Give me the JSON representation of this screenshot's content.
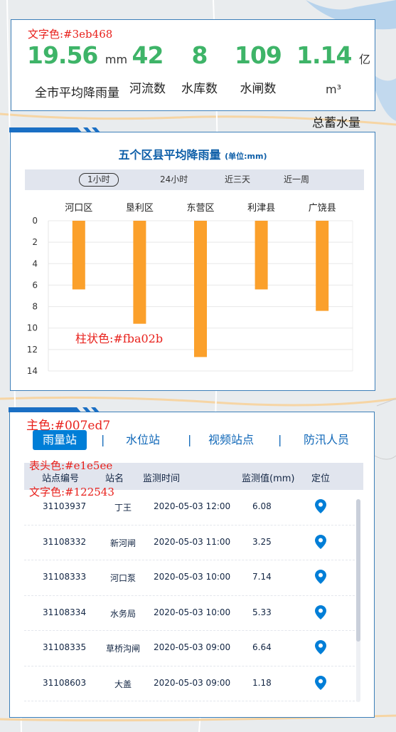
{
  "annotations": {
    "text_color": "文字色:#3eb468",
    "bar_color": "柱状色:#fba02b",
    "main_color": "主色:#007ed7",
    "header_color": "表头色:#e1e5ee",
    "table_text_color": "文字色:#122543"
  },
  "colors": {
    "stat_text": "#3eb468",
    "bar": "#fba02b",
    "primary": "#007ed7",
    "table_header": "#e1e5ee",
    "table_text": "#122543"
  },
  "stats": [
    {
      "value": "19.56",
      "unit": "mm",
      "label": "全市平均降雨量"
    },
    {
      "value": "42",
      "unit": "",
      "label": "河流数"
    },
    {
      "value": "8",
      "unit": "",
      "label": "水库数"
    },
    {
      "value": "109",
      "unit": "",
      "label": "水闸数"
    },
    {
      "value": "1.14",
      "unit": "亿m³",
      "label": "总蓄水量"
    }
  ],
  "chart_panel": {
    "title": "五个区县平均降雨量",
    "unit": "(单位:mm)",
    "tabs": [
      "1小时",
      "24小时",
      "近三天",
      "近一周"
    ],
    "active_tab": 0
  },
  "chart_data": {
    "type": "bar",
    "title": "五个区县平均降雨量",
    "categories": [
      "河口区",
      "垦利区",
      "东营区",
      "利津县",
      "广饶县"
    ],
    "values": [
      6.4,
      9.6,
      12.7,
      6.4,
      8.4
    ],
    "y_ticks": [
      0,
      2,
      4,
      6,
      8,
      10,
      12,
      14
    ],
    "ylim": [
      0,
      14
    ],
    "y_inverted": true,
    "category_axis": "top",
    "grid": true
  },
  "table_panel": {
    "tabs": [
      "雨量站",
      "水位站",
      "视频站点",
      "防汛人员"
    ],
    "active_tab": 0,
    "separator": "|",
    "columns": [
      "站点编号",
      "站名",
      "监测时间",
      "监测值(mm)",
      "定位"
    ],
    "rows": [
      [
        "31103937",
        "丁王",
        "2020-05-03  12:00",
        "6.08"
      ],
      [
        "31108332",
        "新河闸",
        "2020-05-03  11:00",
        "3.25"
      ],
      [
        "31108333",
        "河口泵",
        "2020-05-03  10:00",
        "7.14"
      ],
      [
        "31108334",
        "水务局",
        "2020-05-03  10:00",
        "5.33"
      ],
      [
        "31108335",
        "草桥沟闸",
        "2020-05-03  09:00",
        "6.64"
      ],
      [
        "31108603",
        "大盖",
        "2020-05-03  09:00",
        "1.18"
      ]
    ],
    "location_icon": "map-pin-icon"
  }
}
